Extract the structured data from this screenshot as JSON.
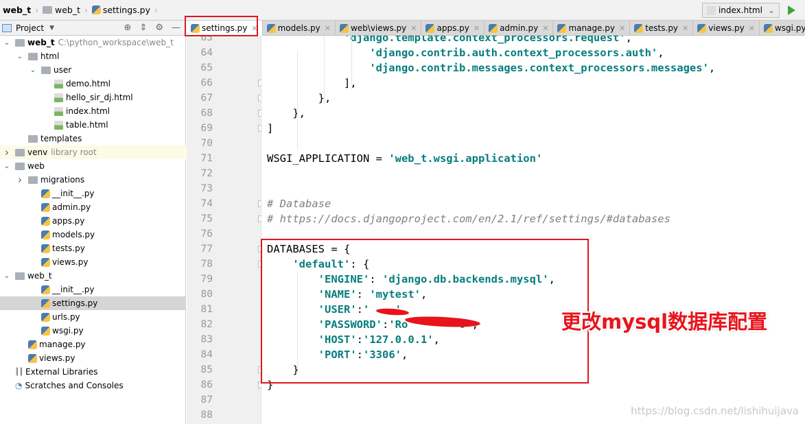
{
  "breadcrumb": {
    "items": [
      "web_t",
      "web_t",
      "settings.py"
    ]
  },
  "run_config": {
    "label": "index.html"
  },
  "project_panel": {
    "title": "Project"
  },
  "tree": [
    {
      "label": "web_t",
      "extra": "C:\\python_workspace\\web_t",
      "depth": 0,
      "icon": "folder",
      "arrow": "down",
      "bold": true
    },
    {
      "label": "html",
      "depth": 1,
      "icon": "folder",
      "arrow": "down"
    },
    {
      "label": "user",
      "depth": 2,
      "icon": "folder",
      "arrow": "down"
    },
    {
      "label": "demo.html",
      "depth": 3,
      "icon": "html"
    },
    {
      "label": "hello_sir_dj.html",
      "depth": 3,
      "icon": "html"
    },
    {
      "label": "index.html",
      "depth": 3,
      "icon": "html"
    },
    {
      "label": "table.html",
      "depth": 3,
      "icon": "html"
    },
    {
      "label": "templates",
      "depth": 1,
      "icon": "folder"
    },
    {
      "label": "venv",
      "extra": "library root",
      "depth": 0,
      "icon": "folder",
      "arrow": "right",
      "lib": true
    },
    {
      "label": "web",
      "depth": 0,
      "icon": "folder",
      "arrow": "down"
    },
    {
      "label": "migrations",
      "depth": 1,
      "icon": "folder",
      "arrow": "right"
    },
    {
      "label": "__init__.py",
      "depth": 2,
      "icon": "python"
    },
    {
      "label": "admin.py",
      "depth": 2,
      "icon": "python"
    },
    {
      "label": "apps.py",
      "depth": 2,
      "icon": "python"
    },
    {
      "label": "models.py",
      "depth": 2,
      "icon": "python"
    },
    {
      "label": "tests.py",
      "depth": 2,
      "icon": "python"
    },
    {
      "label": "views.py",
      "depth": 2,
      "icon": "python"
    },
    {
      "label": "web_t",
      "depth": 0,
      "icon": "folder",
      "arrow": "down"
    },
    {
      "label": "__init__.py",
      "depth": 2,
      "icon": "python"
    },
    {
      "label": "settings.py",
      "depth": 2,
      "icon": "python",
      "selected": true
    },
    {
      "label": "urls.py",
      "depth": 2,
      "icon": "python"
    },
    {
      "label": "wsgi.py",
      "depth": 2,
      "icon": "python"
    },
    {
      "label": "manage.py",
      "depth": 1,
      "icon": "python"
    },
    {
      "label": "views.py",
      "depth": 1,
      "icon": "python"
    },
    {
      "label": "External Libraries",
      "depth": 0,
      "icon": "library"
    },
    {
      "label": "Scratches and Consoles",
      "depth": 0,
      "icon": "scratch"
    }
  ],
  "tabs": [
    "settings.py",
    "models.py",
    "web\\views.py",
    "apps.py",
    "admin.py",
    "manage.py",
    "tests.py",
    "views.py",
    "wsgi.py"
  ],
  "active_tab": "settings.py",
  "code_lines": [
    {
      "n": "63",
      "segs": [
        [
          "            ",
          ""
        ],
        [
          "'django.template.context_processors.request'",
          "s"
        ],
        [
          ",",
          ""
        ]
      ]
    },
    {
      "n": "64",
      "segs": [
        [
          "                ",
          ""
        ],
        [
          "'django.contrib.auth.context_processors.auth'",
          "s"
        ],
        [
          ",",
          ""
        ]
      ]
    },
    {
      "n": "65",
      "segs": [
        [
          "                ",
          ""
        ],
        [
          "'django.contrib.messages.context_processors.messages'",
          "s"
        ],
        [
          ",",
          ""
        ]
      ]
    },
    {
      "n": "66",
      "segs": [
        [
          "            ],",
          ""
        ]
      ]
    },
    {
      "n": "67",
      "segs": [
        [
          "        },",
          ""
        ]
      ]
    },
    {
      "n": "68",
      "segs": [
        [
          "    },",
          ""
        ]
      ]
    },
    {
      "n": "69",
      "segs": [
        [
          "]",
          ""
        ]
      ]
    },
    {
      "n": "70",
      "segs": []
    },
    {
      "n": "71",
      "segs": [
        [
          "WSGI_APPLICATION = ",
          ""
        ],
        [
          "'web_t.wsgi.application'",
          "s"
        ]
      ]
    },
    {
      "n": "72",
      "segs": []
    },
    {
      "n": "73",
      "segs": []
    },
    {
      "n": "74",
      "segs": [
        [
          "# Database",
          "c"
        ]
      ]
    },
    {
      "n": "75",
      "segs": [
        [
          "# https://docs.djangoproject.com/en/2.1/ref/settings/#databases",
          "c"
        ]
      ]
    },
    {
      "n": "76",
      "segs": []
    },
    {
      "n": "77",
      "segs": [
        [
          "DATABASES = {",
          ""
        ]
      ]
    },
    {
      "n": "78",
      "segs": [
        [
          "    ",
          ""
        ],
        [
          "'default'",
          "s"
        ],
        [
          ": {",
          ""
        ]
      ]
    },
    {
      "n": "79",
      "segs": [
        [
          "        ",
          ""
        ],
        [
          "'ENGINE'",
          "s"
        ],
        [
          ": ",
          ""
        ],
        [
          "'django.db.backends.mysql'",
          "s"
        ],
        [
          ",",
          ""
        ]
      ]
    },
    {
      "n": "80",
      "segs": [
        [
          "        ",
          ""
        ],
        [
          "'NAME'",
          "s"
        ],
        [
          ": ",
          ""
        ],
        [
          "'mytest'",
          "s"
        ],
        [
          ",",
          ""
        ]
      ]
    },
    {
      "n": "81",
      "segs": [
        [
          "        ",
          ""
        ],
        [
          "'USER'",
          "s"
        ],
        [
          ":",
          ""
        ],
        [
          "'    '",
          "s"
        ],
        [
          ",",
          ""
        ]
      ]
    },
    {
      "n": "82",
      "segs": [
        [
          "        ",
          ""
        ],
        [
          "'PASSWORD'",
          "s"
        ],
        [
          ":",
          ""
        ],
        [
          "'Ro        0'",
          "s"
        ],
        [
          ",",
          ""
        ]
      ]
    },
    {
      "n": "83",
      "segs": [
        [
          "        ",
          ""
        ],
        [
          "'HOST'",
          "s"
        ],
        [
          ":",
          ""
        ],
        [
          "'127.0.0.1'",
          "s"
        ],
        [
          ",",
          ""
        ]
      ]
    },
    {
      "n": "84",
      "segs": [
        [
          "        ",
          ""
        ],
        [
          "'PORT'",
          "s"
        ],
        [
          ":",
          ""
        ],
        [
          "'3306'",
          "s"
        ],
        [
          ",",
          ""
        ]
      ]
    },
    {
      "n": "85",
      "segs": [
        [
          "    }",
          ""
        ]
      ]
    },
    {
      "n": "86",
      "segs": [
        [
          "}",
          ""
        ]
      ]
    },
    {
      "n": "87",
      "segs": []
    },
    {
      "n": "88",
      "segs": []
    }
  ],
  "annotation": "更改mysql数据库配置",
  "watermark": "https://blog.csdn.net/lishihuijava",
  "colors": {
    "highlight_red": "#e0161f",
    "string": "#067d7d",
    "comment": "#808080"
  }
}
